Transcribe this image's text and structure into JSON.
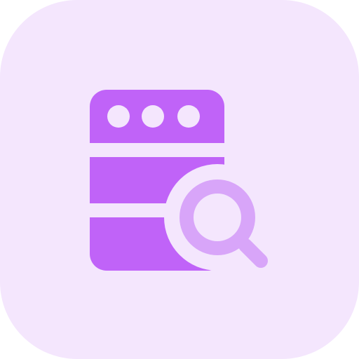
{
  "icon": {
    "name": "server-search-icon",
    "parts": [
      "server-rack",
      "magnifying-glass"
    ]
  },
  "colors": {
    "background_tile": "#F4E6FD",
    "server": "#C063F8",
    "magnifier": "#D8A5F9",
    "cutout": "#F4E6FD",
    "dots": "#F4E6FD"
  }
}
